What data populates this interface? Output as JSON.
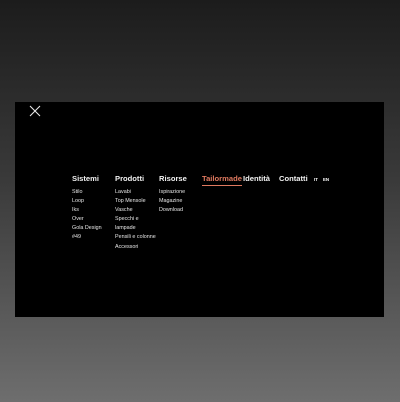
{
  "menu": {
    "columns": [
      {
        "heading": "Sistemi",
        "items": [
          "Stilo",
          "Loop",
          "Iks",
          "Over",
          "Gola Design",
          "#49"
        ]
      },
      {
        "heading": "Prodotti",
        "items": [
          "Lavabi",
          "Top Mensole",
          "Vasche",
          "Specchi e",
          "lampade",
          "Pensili e colonne",
          "Accessori"
        ]
      },
      {
        "heading": "Risorse",
        "items": [
          "Ispirazione",
          "Magazine",
          "Download"
        ]
      }
    ],
    "links": {
      "tailormade": "Tailormade",
      "identita": "Identità",
      "contatti": "Contatti"
    },
    "languages": {
      "it": "IT",
      "en": "EN"
    },
    "accent_color": "#e0795f",
    "close_icon": "close-icon"
  }
}
